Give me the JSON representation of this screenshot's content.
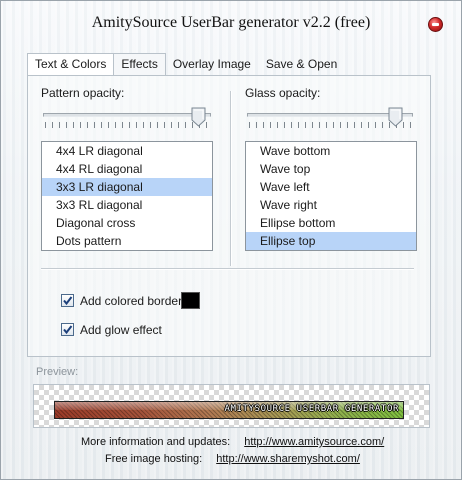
{
  "window": {
    "title": "AmitySource UserBar generator v2.2 (free)"
  },
  "tabs": [
    {
      "label": "Text & Colors",
      "active": true
    },
    {
      "label": "Effects",
      "active": false
    },
    {
      "label": "Overlay Image",
      "active": false
    },
    {
      "label": "Save & Open",
      "active": false
    }
  ],
  "effects": {
    "pattern": {
      "label": "Pattern opacity:",
      "opacity": 0.9,
      "items": [
        "4x4 LR diagonal",
        "4x4 RL diagonal",
        "3x3 LR diagonal",
        "3x3 RL diagonal",
        "Diagonal cross",
        "Dots pattern"
      ],
      "selected": "3x3 LR diagonal"
    },
    "glass": {
      "label": "Glass opacity:",
      "opacity": 0.9,
      "items": [
        "Wave bottom",
        "Wave top",
        "Wave left",
        "Wave right",
        "Ellipse bottom",
        "Ellipse top"
      ],
      "selected": "Ellipse top"
    },
    "border": {
      "label": "Add colored border:",
      "checked": true,
      "color": "#000000"
    },
    "glow": {
      "label": "Add glow effect",
      "checked": true
    }
  },
  "preview": {
    "label": "Preview:",
    "userbar_text": "AMITYSOURCE USERBAR GENERATOR"
  },
  "footer": {
    "info_label": "More information and updates:",
    "info_link": "http://www.amitysource.com/",
    "hosting_label": "Free image hosting:",
    "hosting_link": "http://www.sharemyshot.com/"
  },
  "colors": {
    "selection": "#b8d4f8",
    "close_button": "#d12a2a"
  }
}
